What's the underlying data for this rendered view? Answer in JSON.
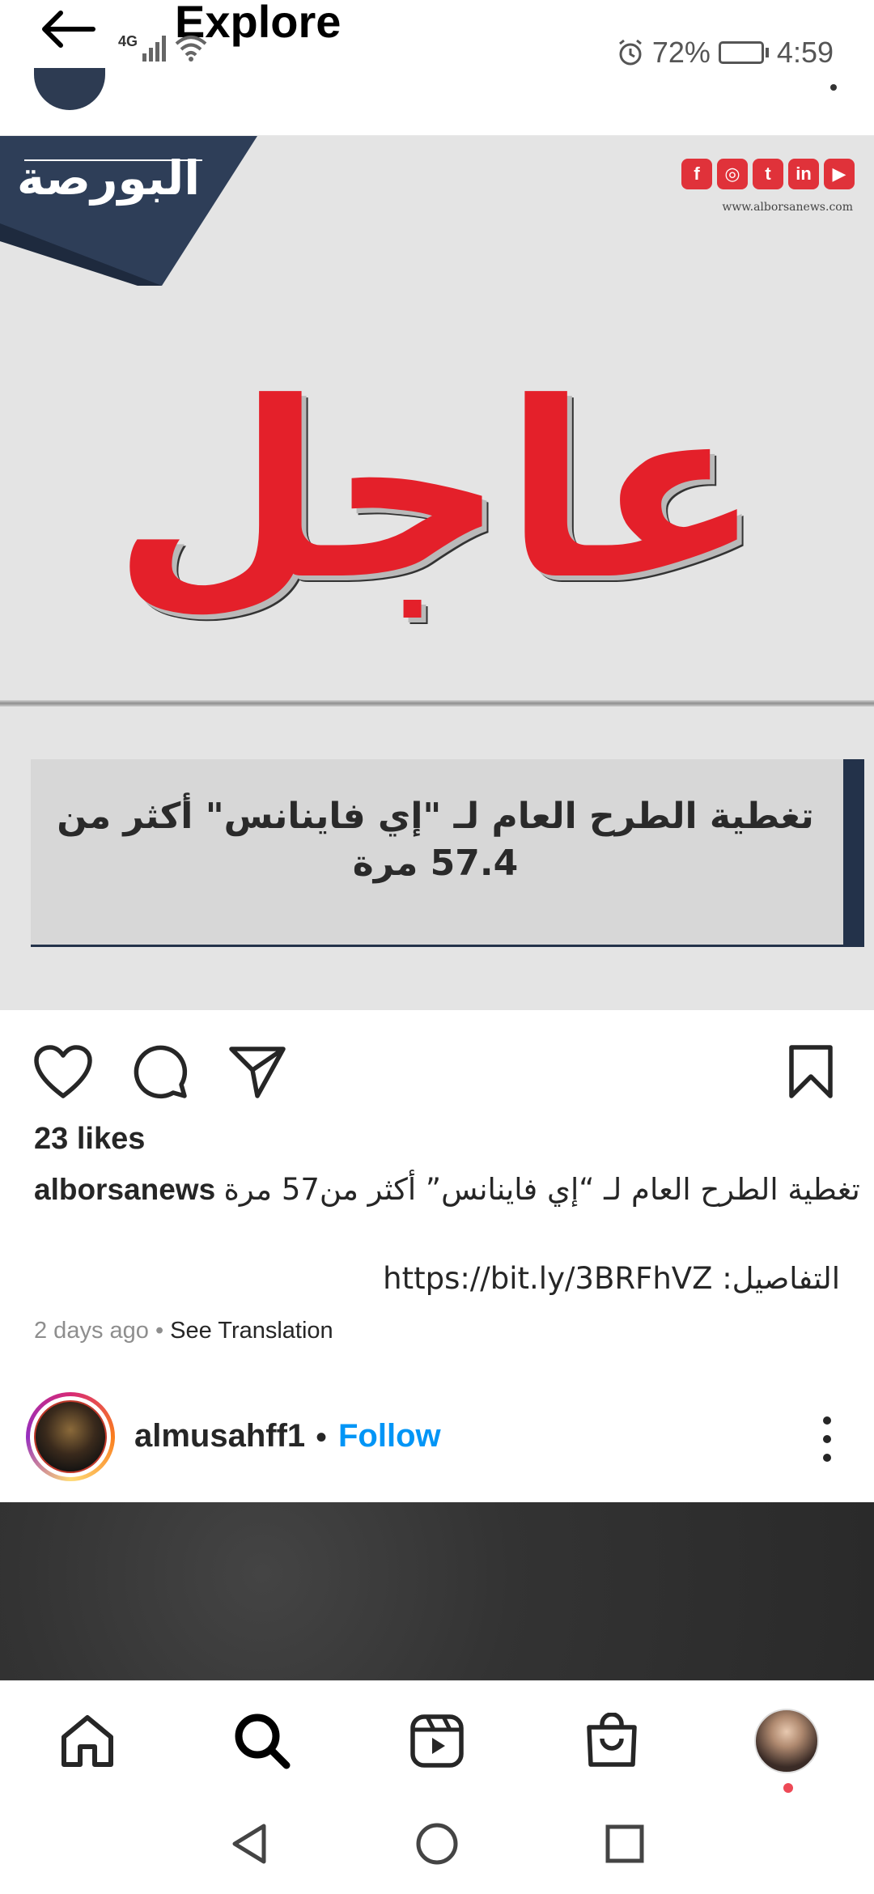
{
  "status_bar": {
    "network": "4G",
    "battery_percent": "72%",
    "battery_level": 0.72,
    "time": "4:59"
  },
  "header": {
    "title": "Explore"
  },
  "post": {
    "image": {
      "brand_name": "البورصة",
      "site_url": "www.alborsanews.com",
      "social_icons": [
        "facebook-icon",
        "instagram-icon",
        "twitter-icon",
        "linkedin-icon",
        "youtube-icon"
      ],
      "breaking_label": "عاجل",
      "headline": "تغطية الطرح العام لـ \"إي فاينانس\" أكثر من 57.4 مرة",
      "colors": {
        "red": "#e4202a",
        "navy": "#23324a",
        "background": "#e4e4e4"
      }
    },
    "likes": "23 likes",
    "caption": {
      "username": "alborsanews",
      "text": "تغطية الطرح العام لـ “إي فاينانس” أكثر من57 مرة",
      "details_label": "التفاصيل:",
      "link": "https://bit.ly/3BRFhVZ"
    },
    "time_ago": "2 days ago",
    "separator": "•",
    "see_translation": "See Translation"
  },
  "next_post": {
    "username": "almusahff1",
    "separator": "•",
    "follow_label": "Follow"
  },
  "bottom_nav": {
    "items": [
      "home-icon",
      "search-icon",
      "reels-icon",
      "shop-icon",
      "profile-avatar"
    ]
  },
  "colors": {
    "follow_blue": "#0095f6",
    "notification_red": "#ed4956"
  }
}
